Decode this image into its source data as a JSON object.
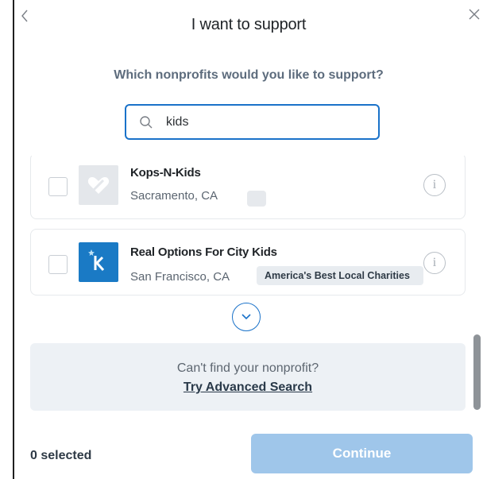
{
  "header": {
    "title": "I want to support",
    "back_icon": "chevron-left-icon",
    "close_icon": "close-icon"
  },
  "prompt": "Which nonprofits would you like to support?",
  "search": {
    "value": "kids",
    "icon": "search-icon"
  },
  "results": [
    {
      "name": "Kops-N-Kids",
      "location": "Sacramento, CA",
      "badge": "",
      "checked": false,
      "logo": "heart-logo"
    },
    {
      "name": "Real Options For City Kids",
      "location": "San Francisco, CA",
      "badge": "America's Best Local Charities",
      "checked": false,
      "logo": "rocky-logo"
    }
  ],
  "info_icon": "info-icon",
  "expand_icon": "chevron-down-circle-icon",
  "advanced": {
    "text": "Can't find your nonprofit?",
    "link": "Try Advanced Search"
  },
  "footer": {
    "selected": "0 selected",
    "continue": "Continue"
  },
  "colors": {
    "accent": "#1a72c9",
    "continue_disabled": "#9fc6ea",
    "panel": "#edf1f5",
    "logo_blue": "#1a7ac5"
  }
}
